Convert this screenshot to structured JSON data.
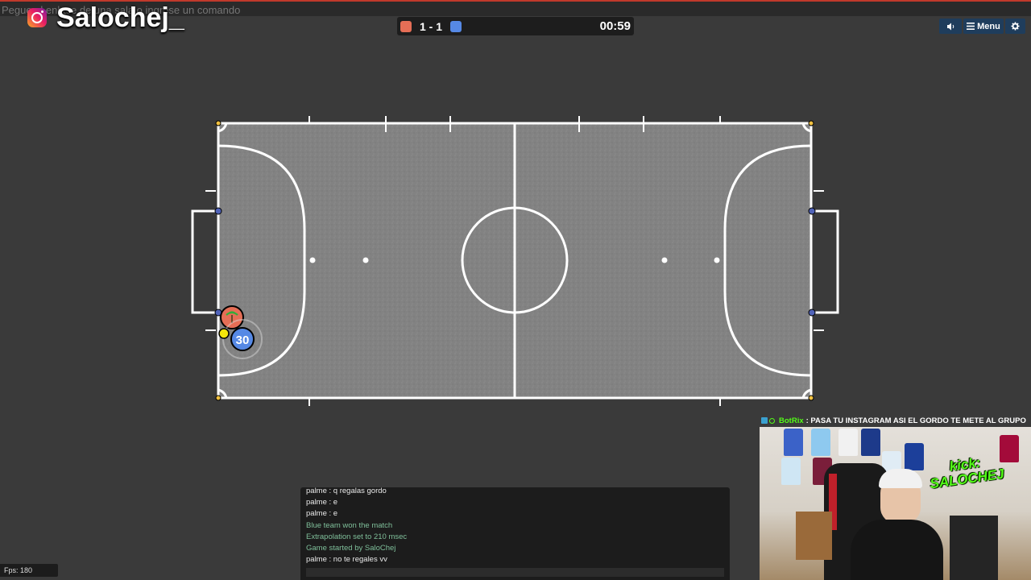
{
  "command_input": {
    "placeholder": "Pegue el enlace de una sala o ingrese un comando"
  },
  "brand": {
    "handle": "Salochej_",
    "icon": "instagram-icon"
  },
  "scoreboard": {
    "score": "1 - 1",
    "time": "00:59",
    "red_color": "#e56e56",
    "blue_color": "#5689e5"
  },
  "top_buttons": {
    "sound_icon": "speaker-icon",
    "menu_label": "Menu",
    "menu_icon": "hamburger-icon",
    "settings_icon": "gear-icon"
  },
  "field": {
    "player_blue_number": "30",
    "player_red_icon": "palm-tree-icon"
  },
  "chat": {
    "lines": [
      {
        "text": "palme : q regalas gordo",
        "kind": "msg"
      },
      {
        "text": "palme : e",
        "kind": "msg"
      },
      {
        "text": "palme : e",
        "kind": "msg"
      },
      {
        "text": "Blue team won the match",
        "kind": "sys"
      },
      {
        "text": "Extrapolation set to 210 msec",
        "kind": "sys"
      },
      {
        "text": "Game started by SaloChej",
        "kind": "sys"
      },
      {
        "text": "palme : no te regales vv",
        "kind": "msg"
      }
    ]
  },
  "fps": {
    "label": "Fps: 180"
  },
  "stream_chat": {
    "user": "BotRix",
    "message": ": PASA TU INSTAGRAM ASI EL GORDO TE METE AL GRUPO"
  },
  "webcam": {
    "overlay_line1": "kick:",
    "overlay_line2": "SALOCHEJ"
  }
}
